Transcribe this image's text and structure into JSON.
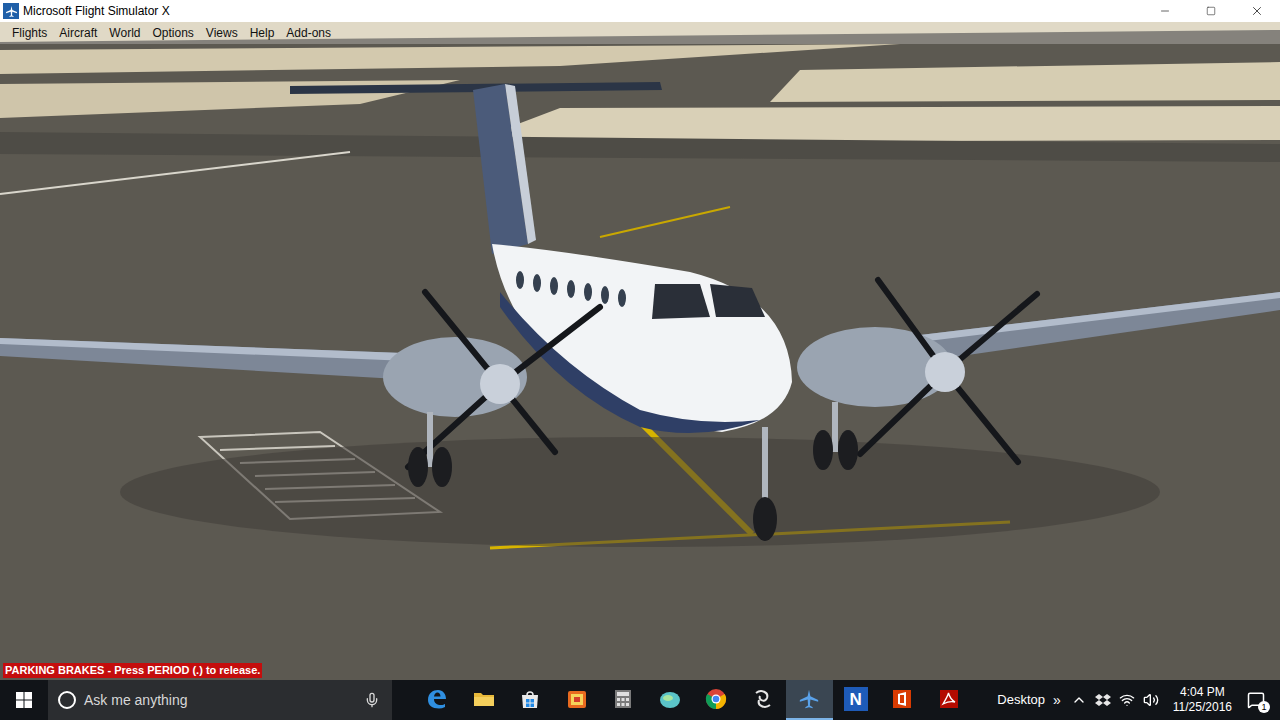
{
  "window": {
    "title": "Microsoft Flight Simulator X"
  },
  "menu": [
    {
      "label": "Flights"
    },
    {
      "label": "Aircraft"
    },
    {
      "label": "World"
    },
    {
      "label": "Options"
    },
    {
      "label": "Views"
    },
    {
      "label": "Help"
    },
    {
      "label": "Add-ons"
    }
  ],
  "game": {
    "message": "PARKING BRAKES - Press PERIOD (.) to release."
  },
  "taskbar": {
    "search": {
      "placeholder": "Ask me anything"
    },
    "apps": [
      {
        "kind": "edge",
        "selected": false
      },
      {
        "kind": "explorer",
        "selected": false
      },
      {
        "kind": "store",
        "selected": false
      },
      {
        "kind": "orange",
        "selected": false
      },
      {
        "kind": "calculator",
        "selected": false
      },
      {
        "kind": "globe",
        "selected": false
      },
      {
        "kind": "chrome",
        "selected": false
      },
      {
        "kind": "steam",
        "selected": false
      },
      {
        "kind": "fsx",
        "selected": true
      },
      {
        "kind": "nitro",
        "selected": false,
        "label": "N"
      },
      {
        "kind": "office",
        "selected": false
      },
      {
        "kind": "acrobat",
        "selected": false
      }
    ],
    "toolbar": "Desktop",
    "toolbar_chevron": "»",
    "clock": {
      "time": "4:04 PM",
      "date": "11/25/2016"
    },
    "notifications": {
      "count": "1"
    }
  }
}
